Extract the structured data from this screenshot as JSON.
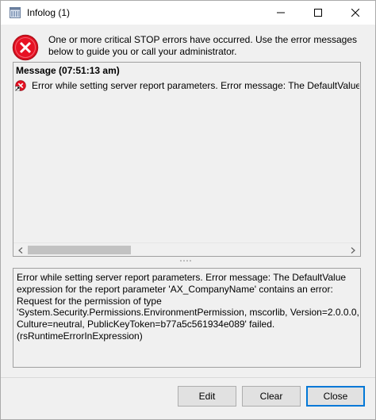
{
  "window": {
    "title": "Infolog (1)"
  },
  "header": {
    "message": "One or more critical STOP errors have occurred. Use the error messages below to guide you or call your administrator."
  },
  "messages": {
    "heading": "Message (07:51:13 am)",
    "items": [
      {
        "text": "Error while setting server report parameters. Error message: The DefaultValue expression for the report parameter 'AX_CompanyName' contains an error:"
      }
    ]
  },
  "detail": {
    "text": "Error while setting server report parameters. Error message: The DefaultValue\nexpression for the report parameter 'AX_CompanyName' contains an error:\nRequest for the permission of type\n'System.Security.Permissions.EnvironmentPermission, mscorlib, Version=2.0.0.0,\nCulture=neutral, PublicKeyToken=b77a5c561934e089' failed.\n(rsRuntimeErrorInExpression)"
  },
  "buttons": {
    "edit": "Edit",
    "clear": "Clear",
    "close": "Close"
  },
  "colors": {
    "error_red": "#e81123",
    "focus_blue": "#0078d7",
    "panel_bg": "#f0f0f0"
  }
}
